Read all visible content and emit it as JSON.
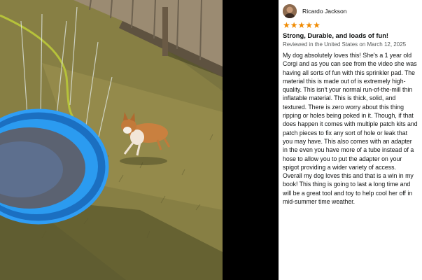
{
  "review": {
    "reviewer_name": "Ricardo Jackson",
    "rating": 5,
    "stars": [
      "★",
      "★",
      "★",
      "★",
      "★"
    ],
    "title": "Strong, Durable, and loads of fun!",
    "meta": "Reviewed in the United States on March 12, 2025",
    "body_paragraph_1": "My dog absolutely loves this! She's a 1 year old Corgi and as you can see from the video she was having all sorts of fun with this sprinkler pad. The material this is made out of is extremely high-quality. This isn't your normal run-of-the-mill thin inflatable material. This is thick, solid, and textured. There is zero worry about this thing ripping or holes being poked in it. Though, if that does happen it comes with multiple patch kits and patch pieces to fix any sort of hole or leak that you may have. This also comes with an adapter in the even you have more of a tube instead of a hose to allow you to put the adapter on your spigot providing a wider variety of access.",
    "body_paragraph_2": "Overall my dog loves this and that is a win in my book! This thing is going to last a long time and will be a great tool and toy to help cool her off in mid-summer time weather."
  },
  "colors": {
    "star": "#f08a00",
    "pool_ring": "#1d8fe0",
    "grass": "#6b6a3a"
  }
}
